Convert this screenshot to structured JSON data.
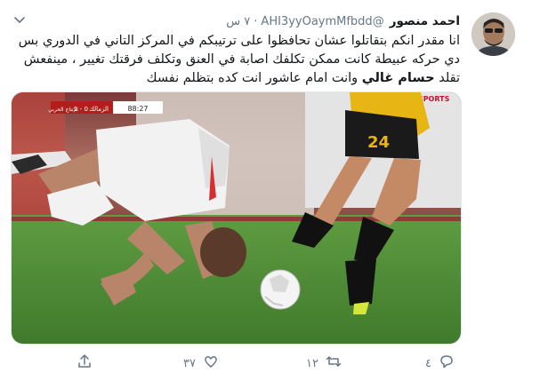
{
  "tweet": {
    "display_name": "احمد منصور",
    "handle": "@AHI3yyOaymMfbdd",
    "time": "٧ س",
    "text_before_bold": "انا مقدر انكم بتقاتلوا عشان تحافظوا على ترتيبكم في المركز التاني في الدوري بس دي حركه عبيطة كانت ممكن تكلفك اصابة في العنق وتكلف فرقتك تغيير ، مينفعش تقلد ",
    "text_bold": "حسام غالي",
    "text_after_bold": " وانت امام عاشور انت كده بتظلم نفسك"
  },
  "scoreboard": {
    "time": "88:27",
    "team_left": "الزمالك",
    "score": "1 - 0",
    "team_right": "الإنتاج الحربي"
  },
  "broadcast_logo": "ON TIME SPORTS",
  "player_number": "24",
  "actions": {
    "reply_count": "٤",
    "retweet_count": "١٢",
    "like_count": "٣٧",
    "share_count": ""
  },
  "icons": {
    "more": "chevron-down-icon",
    "reply": "reply-icon",
    "retweet": "retweet-icon",
    "like": "like-icon",
    "share": "share-icon"
  },
  "colors": {
    "icon_gray": "#657786",
    "text_dark": "#14171a",
    "pitch_green": "#4c8a35",
    "kit_yellow": "#e7b514"
  }
}
